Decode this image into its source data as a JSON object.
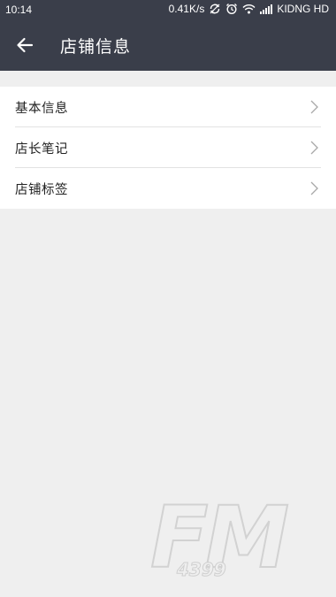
{
  "status_bar": {
    "time": "10:14",
    "network_speed": "0.41K/s",
    "carrier": "KIDNG HD",
    "icons": [
      "sync-icon",
      "alarm-icon",
      "wifi-icon",
      "signal-icon"
    ]
  },
  "app_bar": {
    "title": "店铺信息",
    "back_icon": "arrow-left-icon"
  },
  "menu": {
    "items": [
      {
        "label": "基本信息"
      },
      {
        "label": "店长笔记"
      },
      {
        "label": "店铺标签"
      }
    ]
  },
  "watermark": {
    "logo_text": "FM",
    "logo_number": "4399"
  },
  "colors": {
    "header_bg": "#3a3e4a",
    "page_bg": "#efefef",
    "list_bg": "#ffffff"
  }
}
